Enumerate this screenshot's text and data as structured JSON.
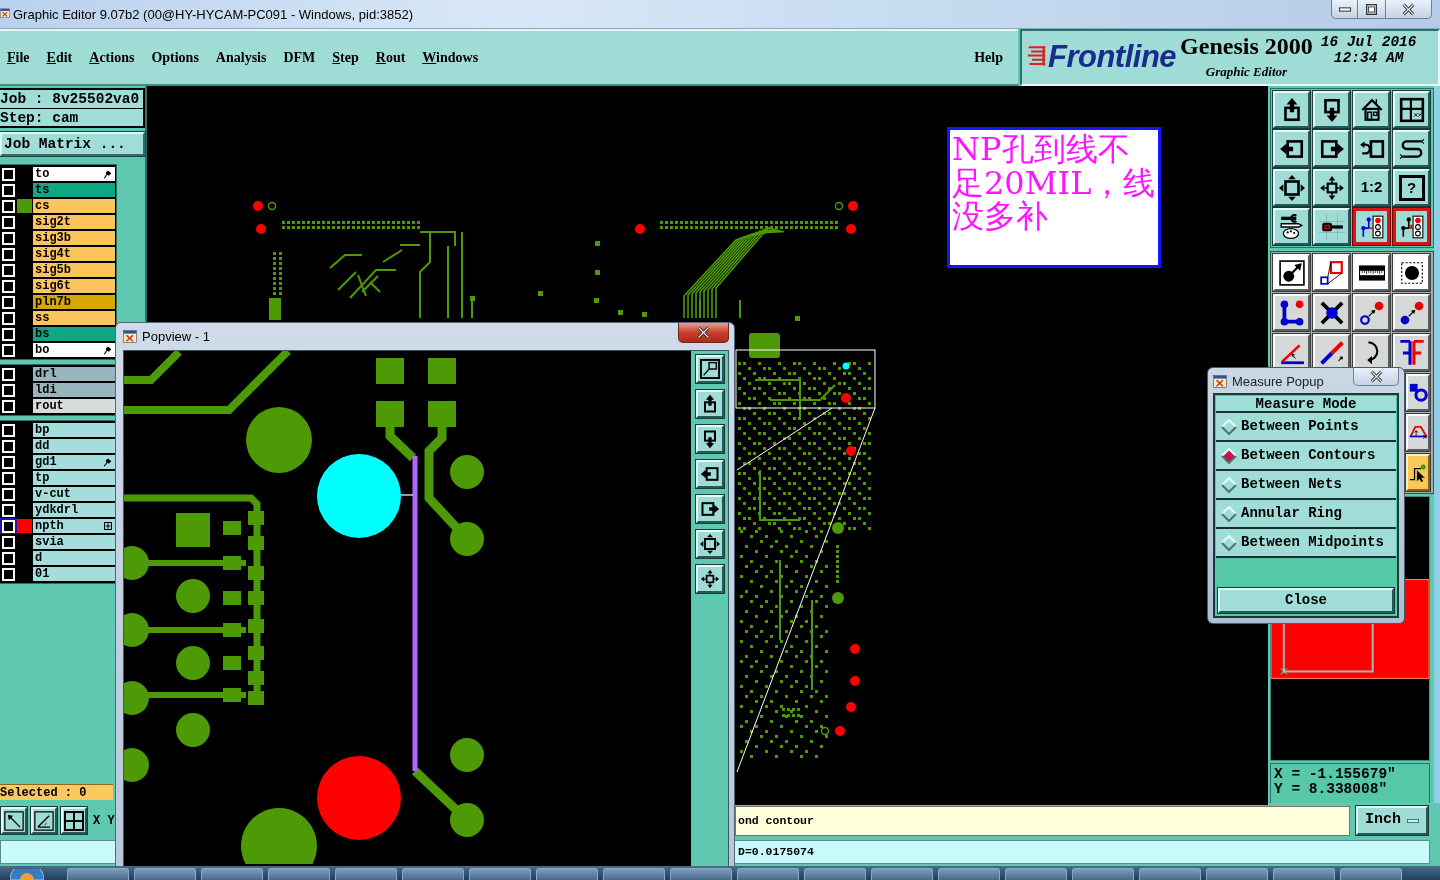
{
  "window": {
    "title": "Graphic Editor 9.07b2 (00@HY-HYCAM-PC091 - Windows, pid:3852)",
    "controls": [
      {
        "kind": "minimize"
      },
      {
        "kind": "maximize"
      },
      {
        "kind": "close"
      }
    ]
  },
  "menu": {
    "items": [
      {
        "label": "File",
        "underlined": true
      },
      {
        "label": "Edit",
        "underlined": true
      },
      {
        "label": "Actions",
        "underlined": true
      },
      {
        "label": "Options",
        "underlined": false
      },
      {
        "label": "Analysis",
        "underlined": false
      },
      {
        "label": "DFM",
        "underlined": false
      },
      {
        "label": "Step",
        "underlined": true
      },
      {
        "label": "Rout",
        "underlined": true
      },
      {
        "label": "Windows",
        "underlined": true
      }
    ],
    "help": {
      "label": "Help",
      "underlined": false
    }
  },
  "branding": {
    "logo": "Frontline",
    "product": "Genesis 2000",
    "module": "Graphic Editor",
    "date": "16 Jul 2016",
    "time": "12:34 AM"
  },
  "job_panel": {
    "job": "Job : 8v25502va0",
    "step": "Step: cam",
    "matrix_button": "Job Matrix ..."
  },
  "layer_groups": [
    {
      "layers": [
        {
          "name": "to",
          "kind": "silk_screen",
          "checked": false,
          "selected": false,
          "flagged": true,
          "expandable": false
        },
        {
          "name": "ts",
          "kind": "solder_mask",
          "checked": false,
          "selected": false,
          "flagged": false,
          "expandable": false
        },
        {
          "name": "cs",
          "kind": "signal",
          "checked": false,
          "selected": false,
          "flagged": false,
          "expandable": false,
          "color": "#4c9a0c"
        },
        {
          "name": "sig2t",
          "kind": "signal",
          "checked": false,
          "selected": false,
          "flagged": false,
          "expandable": false
        },
        {
          "name": "sig3b",
          "kind": "signal",
          "checked": false,
          "selected": false,
          "flagged": false,
          "expandable": false
        },
        {
          "name": "sig4t",
          "kind": "signal",
          "checked": false,
          "selected": false,
          "flagged": false,
          "expandable": false
        },
        {
          "name": "sig5b",
          "kind": "signal",
          "checked": false,
          "selected": false,
          "flagged": false,
          "expandable": false
        },
        {
          "name": "sig6t",
          "kind": "signal",
          "checked": false,
          "selected": false,
          "flagged": false,
          "expandable": false
        },
        {
          "name": "pln7b",
          "kind": "power_ground",
          "checked": false,
          "selected": false,
          "flagged": false,
          "expandable": false
        },
        {
          "name": "ss",
          "kind": "signal",
          "checked": false,
          "selected": false,
          "flagged": false,
          "expandable": false
        },
        {
          "name": "bs",
          "kind": "solder_mask",
          "checked": false,
          "selected": false,
          "flagged": false,
          "expandable": false
        },
        {
          "name": "bo",
          "kind": "silk_screen",
          "checked": false,
          "selected": false,
          "flagged": true,
          "expandable": false
        }
      ]
    },
    {
      "layers": [
        {
          "name": "drl",
          "kind": "drill",
          "checked": false,
          "selected": false,
          "flagged": false,
          "expandable": false
        },
        {
          "name": "ldi",
          "kind": "drill",
          "checked": false,
          "selected": false,
          "flagged": false,
          "expandable": false
        },
        {
          "name": "rout",
          "kind": "rout",
          "checked": false,
          "selected": false,
          "flagged": false,
          "expandable": false
        }
      ]
    },
    {
      "layers": [
        {
          "name": "bp",
          "kind": "document",
          "checked": false,
          "selected": false,
          "flagged": false,
          "expandable": false
        },
        {
          "name": "dd",
          "kind": "document",
          "checked": false,
          "selected": false,
          "flagged": false,
          "expandable": false
        },
        {
          "name": "gd1",
          "kind": "document",
          "checked": false,
          "selected": false,
          "flagged": true,
          "expandable": false
        },
        {
          "name": "tp",
          "kind": "document",
          "checked": false,
          "selected": false,
          "flagged": false,
          "expandable": false
        },
        {
          "name": "v-cut",
          "kind": "document",
          "checked": false,
          "selected": false,
          "flagged": false,
          "expandable": false
        },
        {
          "name": "ydkdrl",
          "kind": "document",
          "checked": false,
          "selected": false,
          "flagged": false,
          "expandable": false
        },
        {
          "name": "npth",
          "kind": "document",
          "checked": false,
          "selected": true,
          "flagged": false,
          "expandable": true,
          "color": "#ff0000"
        },
        {
          "name": "svia",
          "kind": "document",
          "checked": false,
          "selected": false,
          "flagged": false,
          "expandable": false
        },
        {
          "name": "d",
          "kind": "document",
          "checked": false,
          "selected": false,
          "flagged": false,
          "expandable": false
        },
        {
          "name": "01",
          "kind": "document",
          "checked": false,
          "selected": false,
          "flagged": false,
          "expandable": false
        }
      ]
    }
  ],
  "selected_count": "Selected : 0",
  "left_tools": [
    {
      "kind": "diagonal-arrow"
    },
    {
      "kind": "angle-box"
    },
    {
      "kind": "grid-box"
    }
  ],
  "xy_label": "X Y",
  "canvas": {
    "note": "NP孔到线不足20MIL，线没多补"
  },
  "popview": {
    "title": "Popview - 1",
    "tools": [
      {
        "kind": "zoom-window"
      },
      {
        "kind": "box-arrow-up"
      },
      {
        "kind": "box-arrow-down"
      },
      {
        "kind": "arrow-left-box"
      },
      {
        "kind": "arrow-right-box"
      },
      {
        "kind": "fit-screen"
      },
      {
        "kind": "zoom-arrows"
      }
    ]
  },
  "measure_popup": {
    "title": "Measure Popup",
    "heading": "Measure Mode",
    "modes": [
      {
        "label": "Between Points",
        "selected": false
      },
      {
        "label": "Between Contours",
        "selected": true
      },
      {
        "label": "Between Nets",
        "selected": false
      },
      {
        "label": "Annular Ring",
        "selected": false
      },
      {
        "label": "Between Midpoints",
        "selected": false
      }
    ],
    "close_label": "Close"
  },
  "toolbar": {
    "upper": [
      {
        "kind": "box-arrow-up",
        "on": false
      },
      {
        "kind": "box-arrow-down",
        "on": false
      },
      {
        "kind": "house",
        "on": false
      },
      {
        "kind": "window-split",
        "on": false
      },
      {
        "kind": "arrow-left-box",
        "on": false
      },
      {
        "kind": "arrow-right-box",
        "on": false
      },
      {
        "kind": "undo-box",
        "on": false
      },
      {
        "kind": "s-curve",
        "on": false
      },
      {
        "kind": "fit-screen",
        "on": false
      },
      {
        "kind": "zoom-arrows",
        "on": false
      },
      {
        "kind": "text",
        "label": "1:2",
        "on": false
      },
      {
        "kind": "text-framed",
        "label": "?",
        "on": false
      },
      {
        "kind": "tools",
        "on": false
      },
      {
        "kind": "probe",
        "on": false
      },
      {
        "kind": "net-lights",
        "on": true
      },
      {
        "kind": "net-signal",
        "on": true
      }
    ],
    "lower": [
      {
        "kind": "dot-arrow",
        "on": true
      },
      {
        "kind": "shape-pair",
        "on": true
      },
      {
        "kind": "ruler",
        "on": true
      },
      {
        "kind": "dot-dashed-box",
        "on": true
      },
      {
        "kind": "connected-dots",
        "on": false
      },
      {
        "kind": "cross-dot",
        "on": false
      },
      {
        "kind": "ring-to-dot",
        "on": false
      },
      {
        "kind": "dot-to-dot",
        "on": false
      },
      {
        "kind": "angle",
        "on": false
      },
      {
        "kind": "diagonal",
        "on": false
      },
      {
        "kind": "curved-arrow",
        "on": false
      },
      {
        "kind": "mirror-f",
        "on": false
      }
    ],
    "side": [
      {
        "kind": "shape-cluster",
        "on": false
      },
      {
        "kind": "trapezoid",
        "on": false
      },
      {
        "kind": "cursor-step",
        "on": true
      }
    ]
  },
  "coordinates": {
    "x": "X = -1.155679\"",
    "y": "Y = 8.338008\""
  },
  "prompt": {
    "text": "ond contour"
  },
  "units": {
    "label": "Inch"
  },
  "status": {
    "text": "D=0.0175074"
  }
}
